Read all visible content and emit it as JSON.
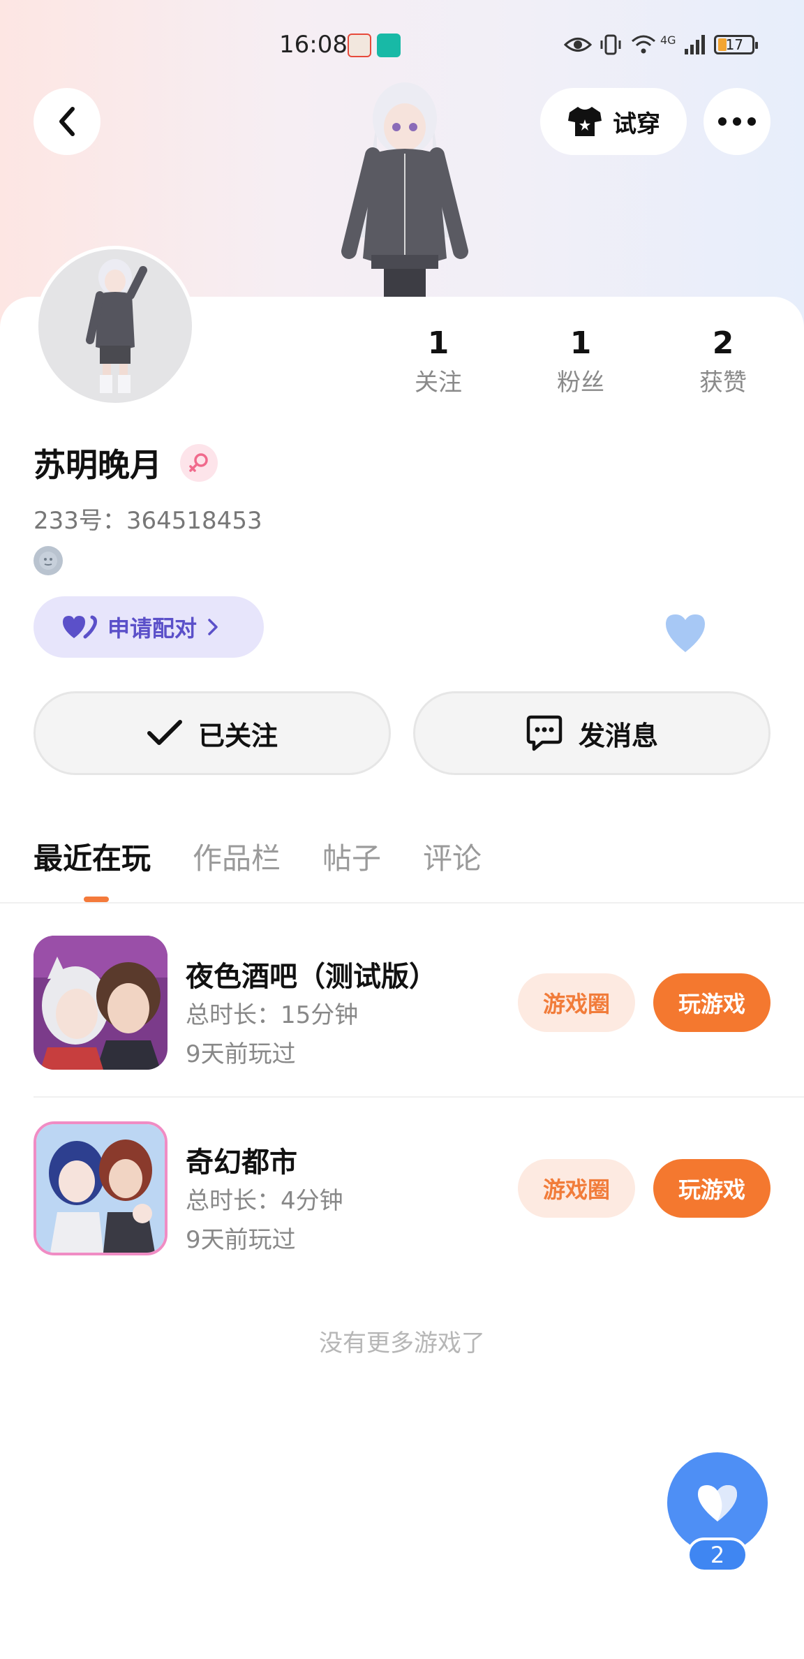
{
  "status_bar": {
    "time": "16:08",
    "network": "4G",
    "battery": "17"
  },
  "top_bar": {
    "try_on_label": "试穿"
  },
  "profile": {
    "name": "苏明晚月",
    "uid": "233号：364518453",
    "stats": [
      {
        "value": "1",
        "label": "关注"
      },
      {
        "value": "1",
        "label": "粉丝"
      },
      {
        "value": "2",
        "label": "获赞"
      }
    ],
    "pair_label": "申请配对"
  },
  "actions": {
    "followed_label": "已关注",
    "message_label": "发消息"
  },
  "tabs": [
    {
      "label": "最近在玩",
      "active": true
    },
    {
      "label": "作品栏",
      "active": false
    },
    {
      "label": "帖子",
      "active": false
    },
    {
      "label": "评论",
      "active": false
    }
  ],
  "games": [
    {
      "title": "夜色酒吧（测试版）",
      "duration": "总时长：15分钟",
      "last_played": "9天前玩过",
      "circle_label": "游戏圈",
      "play_label": "玩游戏"
    },
    {
      "title": "奇幻都市",
      "duration": "总时长：4分钟",
      "last_played": "9天前玩过",
      "circle_label": "游戏圈",
      "play_label": "玩游戏"
    }
  ],
  "footer_text": "没有更多游戏了",
  "like_fab": {
    "count": "2"
  },
  "colors": {
    "accent": "#f4782f",
    "fab": "#4e8ff5",
    "pair": "#5b50c9"
  }
}
